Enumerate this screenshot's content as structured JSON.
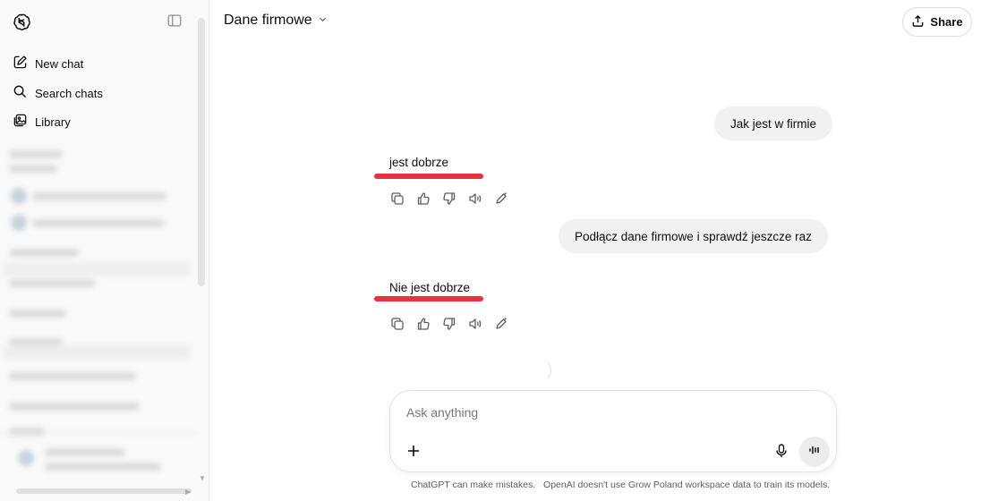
{
  "sidebar": {
    "logo_icon": "openai-logo-icon",
    "toggle_icon": "sidebar-toggle-icon",
    "items": [
      {
        "label": "New chat",
        "icon": "compose-icon"
      },
      {
        "label": "Search chats",
        "icon": "search-icon"
      },
      {
        "label": "Library",
        "icon": "library-icon"
      }
    ]
  },
  "header": {
    "title": "Dane firmowe",
    "share_label": "Share"
  },
  "conversation": {
    "messages": [
      {
        "role": "user",
        "text": "Jak jest w firmie"
      },
      {
        "role": "assistant",
        "text": "jest dobrze"
      },
      {
        "role": "user",
        "text": "Podłącz dane firmowe i sprawdź jeszcze raz"
      },
      {
        "role": "assistant",
        "text": "Nie jest dobrze"
      }
    ],
    "annotation_color": "#e8333f"
  },
  "composer": {
    "placeholder": "Ask anything"
  },
  "footer": {
    "disclaimer": "ChatGPT can make mistakes.   OpenAI doesn't use Grow Poland workspace data to train its models."
  }
}
